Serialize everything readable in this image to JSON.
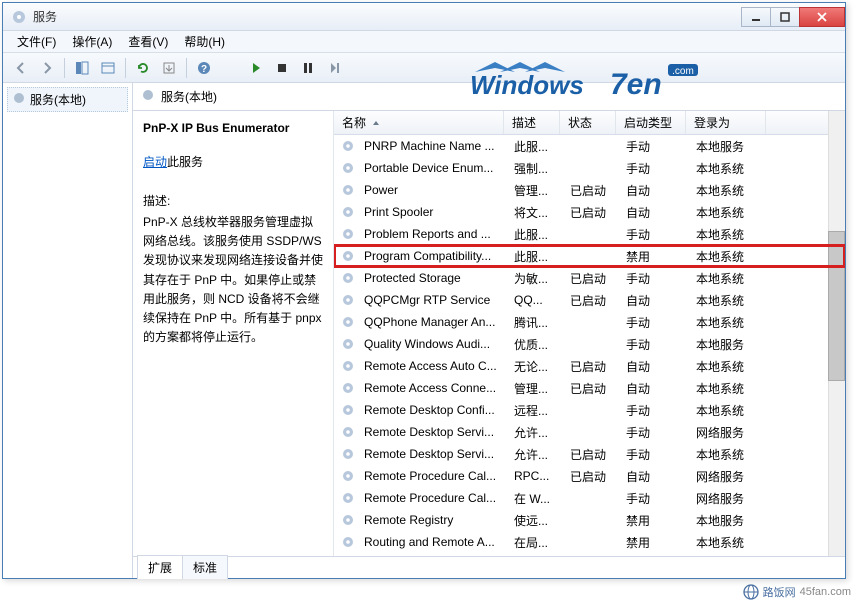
{
  "window": {
    "title": "服务"
  },
  "menubar": [
    {
      "label": "文件(F)"
    },
    {
      "label": "操作(A)"
    },
    {
      "label": "查看(V)"
    },
    {
      "label": "帮助(H)"
    }
  ],
  "tree": {
    "root_label": "服务(本地)"
  },
  "content": {
    "header": "服务(本地)",
    "detail": {
      "title": "PnP-X IP Bus Enumerator",
      "start_action_prefix": "启动",
      "start_action_suffix": "此服务",
      "desc_label": "描述:",
      "description": "PnP-X 总线枚举器服务管理虚拟网络总线。该服务使用 SSDP/WS 发现协议来发现网络连接设备并使其存在于 PnP 中。如果停止或禁用此服务，则 NCD 设备将不会继续保持在 PnP 中。所有基于 pnpx 的方案都将停止运行。"
    },
    "columns": {
      "name": "名称",
      "desc": "描述",
      "status": "状态",
      "start": "启动类型",
      "logon": "登录为"
    },
    "rows": [
      {
        "name": "PNRP Machine Name ...",
        "desc": "此服...",
        "status": "",
        "start": "手动",
        "logon": "本地服务"
      },
      {
        "name": "Portable Device Enum...",
        "desc": "强制...",
        "status": "",
        "start": "手动",
        "logon": "本地系统"
      },
      {
        "name": "Power",
        "desc": "管理...",
        "status": "已启动",
        "start": "自动",
        "logon": "本地系统"
      },
      {
        "name": "Print Spooler",
        "desc": "将文...",
        "status": "已启动",
        "start": "自动",
        "logon": "本地系统"
      },
      {
        "name": "Problem Reports and ...",
        "desc": "此服...",
        "status": "",
        "start": "手动",
        "logon": "本地系统"
      },
      {
        "name": "Program Compatibility...",
        "desc": "此服...",
        "status": "",
        "start": "禁用",
        "logon": "本地系统",
        "highlight": true
      },
      {
        "name": "Protected Storage",
        "desc": "为敏...",
        "status": "已启动",
        "start": "手动",
        "logon": "本地系统"
      },
      {
        "name": "QQPCMgr RTP Service",
        "desc": "QQ...",
        "status": "已启动",
        "start": "自动",
        "logon": "本地系统"
      },
      {
        "name": "QQPhone Manager An...",
        "desc": "腾讯...",
        "status": "",
        "start": "手动",
        "logon": "本地系统"
      },
      {
        "name": "Quality Windows Audi...",
        "desc": "优质...",
        "status": "",
        "start": "手动",
        "logon": "本地服务"
      },
      {
        "name": "Remote Access Auto C...",
        "desc": "无论...",
        "status": "已启动",
        "start": "自动",
        "logon": "本地系统"
      },
      {
        "name": "Remote Access Conne...",
        "desc": "管理...",
        "status": "已启动",
        "start": "自动",
        "logon": "本地系统"
      },
      {
        "name": "Remote Desktop Confi...",
        "desc": "远程...",
        "status": "",
        "start": "手动",
        "logon": "本地系统"
      },
      {
        "name": "Remote Desktop Servi...",
        "desc": "允许...",
        "status": "",
        "start": "手动",
        "logon": "网络服务"
      },
      {
        "name": "Remote Desktop Servi...",
        "desc": "允许...",
        "status": "已启动",
        "start": "手动",
        "logon": "本地系统"
      },
      {
        "name": "Remote Procedure Cal...",
        "desc": "RPC...",
        "status": "已启动",
        "start": "自动",
        "logon": "网络服务"
      },
      {
        "name": "Remote Procedure Cal...",
        "desc": "在 W...",
        "status": "",
        "start": "手动",
        "logon": "网络服务"
      },
      {
        "name": "Remote Registry",
        "desc": "使远...",
        "status": "",
        "start": "禁用",
        "logon": "本地服务"
      },
      {
        "name": "Routing and Remote A...",
        "desc": "在局...",
        "status": "",
        "start": "禁用",
        "logon": "本地系统"
      }
    ],
    "tabs": {
      "extended": "扩展",
      "standard": "标准"
    }
  },
  "watermark": {
    "brand_main": "Windows",
    "brand_suffix": "7en",
    "brand_tld": ".com",
    "footer_name": "路饭网",
    "footer_url": "45fan.com"
  }
}
